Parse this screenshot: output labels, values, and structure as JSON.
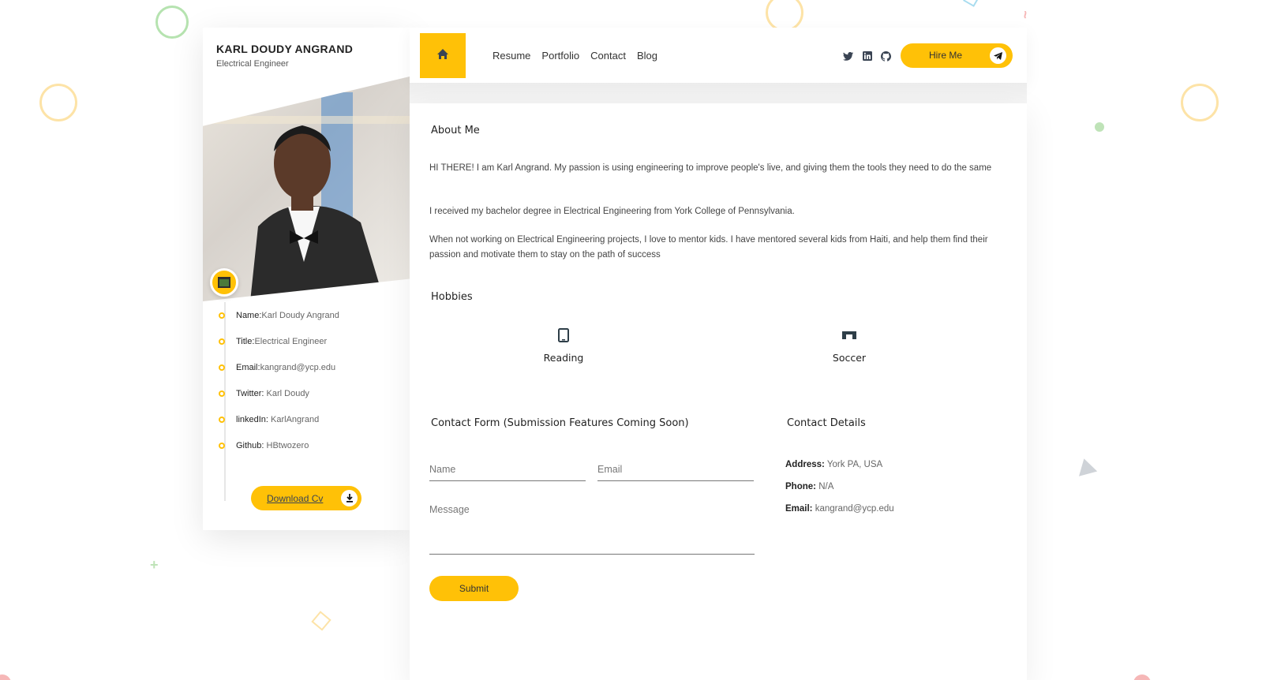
{
  "profile": {
    "name": "KARL DOUDY ANGRAND",
    "title": "Electrical Engineer",
    "info": [
      {
        "label": "Name:",
        "value": "Karl Doudy Angrand"
      },
      {
        "label": "Title:",
        "value": "Electrical Engineer"
      },
      {
        "label": "Email:",
        "value": "kangrand@ycp.edu"
      },
      {
        "label": "Twitter: ",
        "value": "Karl Doudy"
      },
      {
        "label": "linkedIn: ",
        "value": "KarlAngrand"
      },
      {
        "label": "Github: ",
        "value": "HBtwozero"
      }
    ],
    "download_label": "Download Cv"
  },
  "nav": {
    "links": [
      "Resume",
      "Portfolio",
      "Contact",
      "Blog"
    ],
    "hire_label": "Hire Me",
    "socials": [
      "twitter-icon",
      "linkedin-icon",
      "github-icon"
    ]
  },
  "about": {
    "title": "About Me",
    "paragraphs": [
      "HI THERE! I am Karl Angrand. My passion is using engineering to improve people's live, and giving them the tools they need to do the same",
      "I received my bachelor degree in Electrical Engineering from York College of Pennsylvania.",
      "When not working on Electrical Engineering projects, I love to mentor kids. I have mentored several kids from Haiti, and help them find their passion and motivate them to stay on the path of success"
    ]
  },
  "hobbies": {
    "title": "Hobbies",
    "items": [
      {
        "label": "Reading",
        "icon": "tablet-icon"
      },
      {
        "label": "Soccer",
        "icon": "goal-icon"
      }
    ]
  },
  "contact_form": {
    "title": "Contact Form (Submission Features Coming Soon)",
    "name_placeholder": "Name",
    "email_placeholder": "Email",
    "message_placeholder": "Message",
    "submit_label": "Submit"
  },
  "contact_details": {
    "title": "Contact Details",
    "address_label": "Address:",
    "address_value": "York PA, USA",
    "phone_label": "Phone:",
    "phone_value": "N/A",
    "email_label": "Email:",
    "email_value": "kangrand@ycp.edu"
  },
  "colors": {
    "accent": "#ffc107",
    "text": "#333333"
  }
}
